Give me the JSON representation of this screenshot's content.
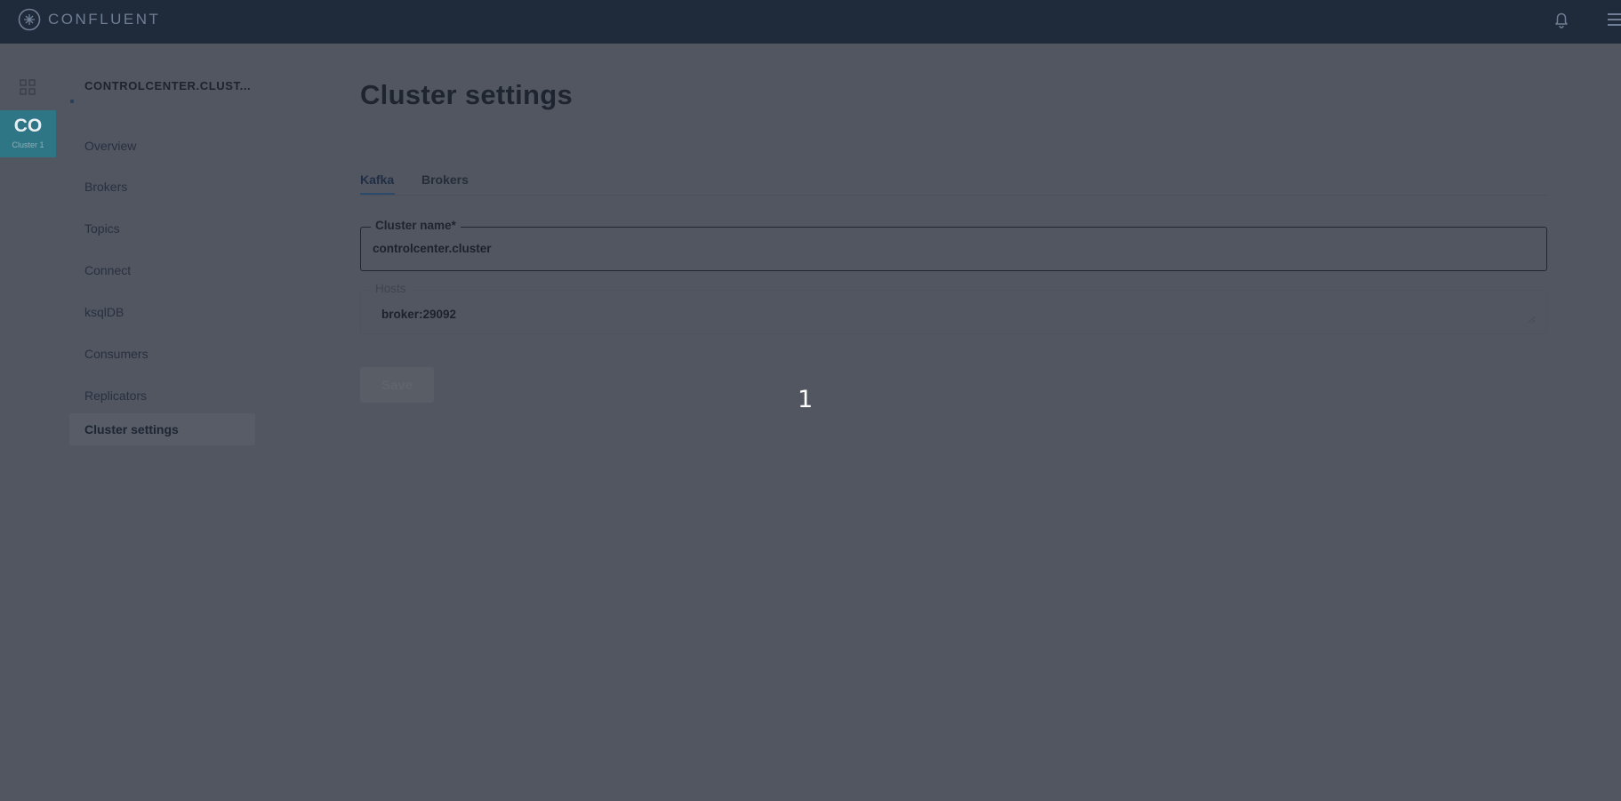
{
  "topbar": {
    "brand": "CONFLUENT",
    "icons": [
      "confluent-logo-icon",
      "bell-icon",
      "hamburger-menu-icon"
    ]
  },
  "app_rail": {
    "icons": [
      "apps-grid-icon"
    ],
    "cluster_tile": {
      "abbr": "CO",
      "name": "Cluster 1",
      "color": "#2e7585"
    }
  },
  "nav": {
    "cluster_title": "CONTROLCENTER.CLUST...",
    "items": [
      {
        "label": "Overview"
      },
      {
        "label": "Brokers"
      },
      {
        "label": "Topics"
      },
      {
        "label": "Connect"
      },
      {
        "label": "ksqlDB"
      },
      {
        "label": "Consumers"
      },
      {
        "label": "Replicators"
      },
      {
        "label": "Cluster settings",
        "active": true
      }
    ]
  },
  "main": {
    "title": "Cluster settings",
    "tabs": [
      {
        "label": "Kafka",
        "active": true
      },
      {
        "label": "Brokers"
      }
    ],
    "fields": {
      "cluster_name": {
        "label": "Cluster name*",
        "value": "controlcenter.cluster"
      },
      "hosts": {
        "label": "Hosts",
        "value": "broker:29092"
      }
    },
    "save_label": "Save"
  },
  "overlay": {
    "step_marker": "1"
  },
  "colors": {
    "topbar": "#1f2a3a",
    "background": "#525661",
    "accent": "#2c4a6c",
    "tile": "#2e7585"
  }
}
